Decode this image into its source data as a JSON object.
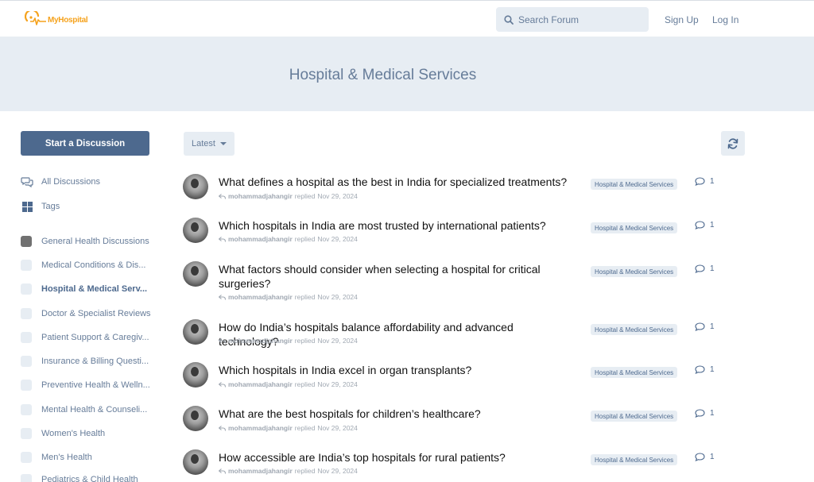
{
  "brand": {
    "logo_text": "MyHospital"
  },
  "header": {
    "search_placeholder": "Search Forum",
    "signup_label": "Sign Up",
    "login_label": "Log In"
  },
  "hero": {
    "title": "Hospital & Medical Services"
  },
  "sidebar": {
    "start_button": "Start a Discussion",
    "nav": [
      {
        "label": "All Discussions",
        "icon": "comments-icon"
      },
      {
        "label": "Tags",
        "icon": "grid-icon"
      }
    ],
    "tags": [
      {
        "label": "General Health Discussions"
      },
      {
        "label": "Medical Conditions & Dis..."
      },
      {
        "label": "Hospital & Medical Serv..."
      },
      {
        "label": "Doctor & Specialist Reviews"
      },
      {
        "label": "Patient Support & Caregiv..."
      },
      {
        "label": "Insurance & Billing Questi..."
      },
      {
        "label": "Preventive Health & Welln..."
      },
      {
        "label": "Mental Health & Counseli..."
      },
      {
        "label": "Women's Health"
      },
      {
        "label": "Men's Health"
      },
      {
        "label": "Pediatrics & Child Health"
      }
    ]
  },
  "toolbar": {
    "sort_label": "Latest"
  },
  "discussions": [
    {
      "title": "What defines a hospital as the best in India for specialized treatments?",
      "user": "mohammadjahangir",
      "action": "replied",
      "date": "Nov 29, 2024",
      "tag": "Hospital & Medical Services",
      "replies": "1"
    },
    {
      "title": "Which hospitals in India are most trusted by international patients?",
      "user": "mohammadjahangir",
      "action": "replied",
      "date": "Nov 29, 2024",
      "tag": "Hospital & Medical Services",
      "replies": "1"
    },
    {
      "title": "What factors should consider when selecting a hospital for critical surgeries?",
      "user": "mohammadjahangir",
      "action": "replied",
      "date": "Nov 29, 2024",
      "tag": "Hospital & Medical Services",
      "replies": "1"
    },
    {
      "title": "How do India’s hospitals balance affordability and advanced technology?",
      "user": "mohammadjahangir",
      "action": "replied",
      "date": "Nov 29, 2024",
      "tag": "Hospital & Medical Services",
      "replies": "1"
    },
    {
      "title": "Which hospitals in India excel in organ transplants?",
      "user": "mohammadjahangir",
      "action": "replied",
      "date": "Nov 29, 2024",
      "tag": "Hospital & Medical Services",
      "replies": "1"
    },
    {
      "title": "What are the best hospitals for children’s healthcare?",
      "user": "mohammadjahangir",
      "action": "replied",
      "date": "Nov 29, 2024",
      "tag": "Hospital & Medical Services",
      "replies": "1"
    },
    {
      "title": "How accessible are India’s top hospitals for rural patients?",
      "user": "mohammadjahangir",
      "action": "replied",
      "date": "Nov 29, 2024",
      "tag": "Hospital & Medical Services",
      "replies": "1"
    }
  ]
}
